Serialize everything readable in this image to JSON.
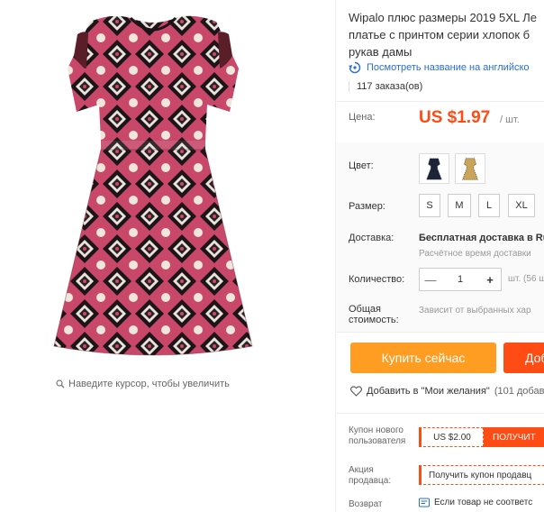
{
  "gallery": {
    "zoom_hint": "Наведите курсор, чтобы увеличить"
  },
  "product": {
    "title_line1": "Wipalo плюс размеры 2019 5XL Ле",
    "title_line2": "платье с принтом серии хлопок б",
    "title_line3": "рукав дамы",
    "translate_link": "Посмотреть название на английско",
    "orders": "117 заказа(ов)"
  },
  "price": {
    "label": "Цена:",
    "value": "US $1.97",
    "unit": "/ шт."
  },
  "color": {
    "label": "Цвет:",
    "swatches": [
      "navy-dress",
      "beige-dress"
    ]
  },
  "size": {
    "label": "Размер:",
    "options": [
      "S",
      "M",
      "L",
      "XL"
    ]
  },
  "shipping": {
    "label": "Доставка:",
    "main": "Бесплатная доставка в Ru",
    "sub": "Расчётное время доставки"
  },
  "quantity": {
    "label": "Количество:",
    "minus": "—",
    "value": "1",
    "plus": "+",
    "note": "шт. (56 ш"
  },
  "total": {
    "label_line1": "Общая",
    "label_line2": "стоимость:",
    "value": "Зависит от выбранных хар"
  },
  "actions": {
    "buy_now": "Купить сейчас",
    "add_to_cart": "Доб"
  },
  "wishlist": {
    "label": "Добавить в \"Мои желания\"",
    "count": "(101 добав"
  },
  "coupon": {
    "label_line1": "Купон нового",
    "label_line2": "пользователя",
    "value": "US $2.00",
    "get": "ПОЛУЧИТ"
  },
  "seller_promo": {
    "label_line1": "Акция",
    "label_line2": "продавца:",
    "value": "Получить купон продавц"
  },
  "returns": {
    "label": "Возврат",
    "value": "Если товар не соответс"
  },
  "colors": {
    "accent_orange": "#ff9c22",
    "accent_red": "#ff4b14",
    "link_blue": "#2a6ecf"
  }
}
